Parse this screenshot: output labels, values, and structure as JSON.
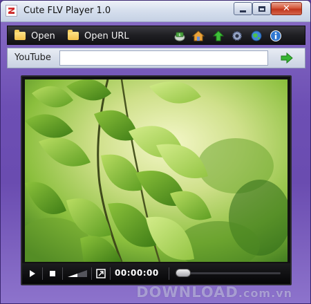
{
  "window": {
    "title": "Cute FLV Player 1.0"
  },
  "caption_buttons": {
    "minimize": "",
    "maximize": "",
    "close": "✕"
  },
  "toolbar": {
    "open_label": "Open",
    "open_url_label": "Open URL",
    "icons": [
      "money-icon",
      "home-icon",
      "up-arrow-icon",
      "settings-gear-icon",
      "globe-icon",
      "info-icon"
    ]
  },
  "urlbar": {
    "label": "YouTube",
    "value": "",
    "placeholder": ""
  },
  "player": {
    "time": "00:00:00",
    "seek_position": 0,
    "volume_level": 0.5
  },
  "watermark": {
    "main": "DOWNLOAD",
    "suffix": ".com.vn"
  },
  "colors": {
    "frame": "#6d4fb4",
    "toolbar": "#1f1f23",
    "accent_green": "#33a832",
    "close_red": "#c1361c"
  }
}
